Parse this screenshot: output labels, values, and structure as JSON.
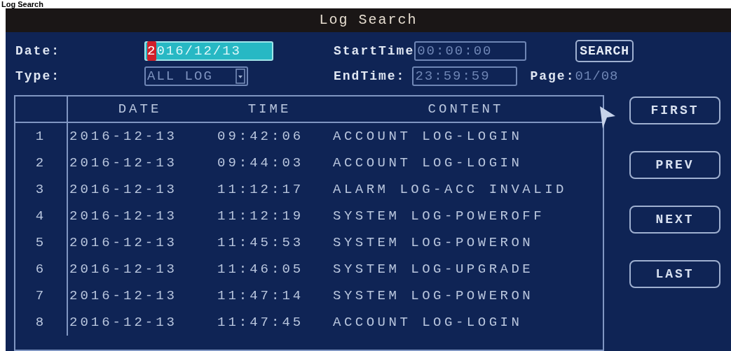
{
  "page_heading": "Log Search",
  "window": {
    "title": "Log Search"
  },
  "form": {
    "date": {
      "label": "Date:",
      "value": "2016/12/13",
      "focused": true
    },
    "type": {
      "label": "Type:",
      "value": "ALL LOG"
    },
    "start_time": {
      "label": "StartTime",
      "value": "00:00:00"
    },
    "end_time": {
      "label": "EndTime:",
      "value": "23:59:59"
    },
    "search_button": "SEARCH",
    "page": {
      "label": "Page:",
      "value": "01/08"
    }
  },
  "table": {
    "columns": [
      "DATE",
      "TIME",
      "CONTENT"
    ],
    "rows": [
      {
        "index": "1",
        "date": "2016-12-13",
        "time": "09:42:06",
        "content": "ACCOUNT LOG-LOGIN"
      },
      {
        "index": "2",
        "date": "2016-12-13",
        "time": "09:44:03",
        "content": "ACCOUNT LOG-LOGIN"
      },
      {
        "index": "3",
        "date": "2016-12-13",
        "time": "11:12:17",
        "content": "ALARM LOG-ACC INVALID"
      },
      {
        "index": "4",
        "date": "2016-12-13",
        "time": "11:12:19",
        "content": "SYSTEM LOG-POWEROFF"
      },
      {
        "index": "5",
        "date": "2016-12-13",
        "time": "11:45:53",
        "content": "SYSTEM LOG-POWERON"
      },
      {
        "index": "6",
        "date": "2016-12-13",
        "time": "11:46:05",
        "content": "SYSTEM LOG-UPGRADE"
      },
      {
        "index": "7",
        "date": "2016-12-13",
        "time": "11:47:14",
        "content": "SYSTEM LOG-POWERON"
      },
      {
        "index": "8",
        "date": "2016-12-13",
        "time": "11:47:45",
        "content": "ACCOUNT LOG-LOGIN"
      }
    ]
  },
  "nav_buttons": [
    "FIRST",
    "PREV",
    "NEXT",
    "LAST"
  ]
}
